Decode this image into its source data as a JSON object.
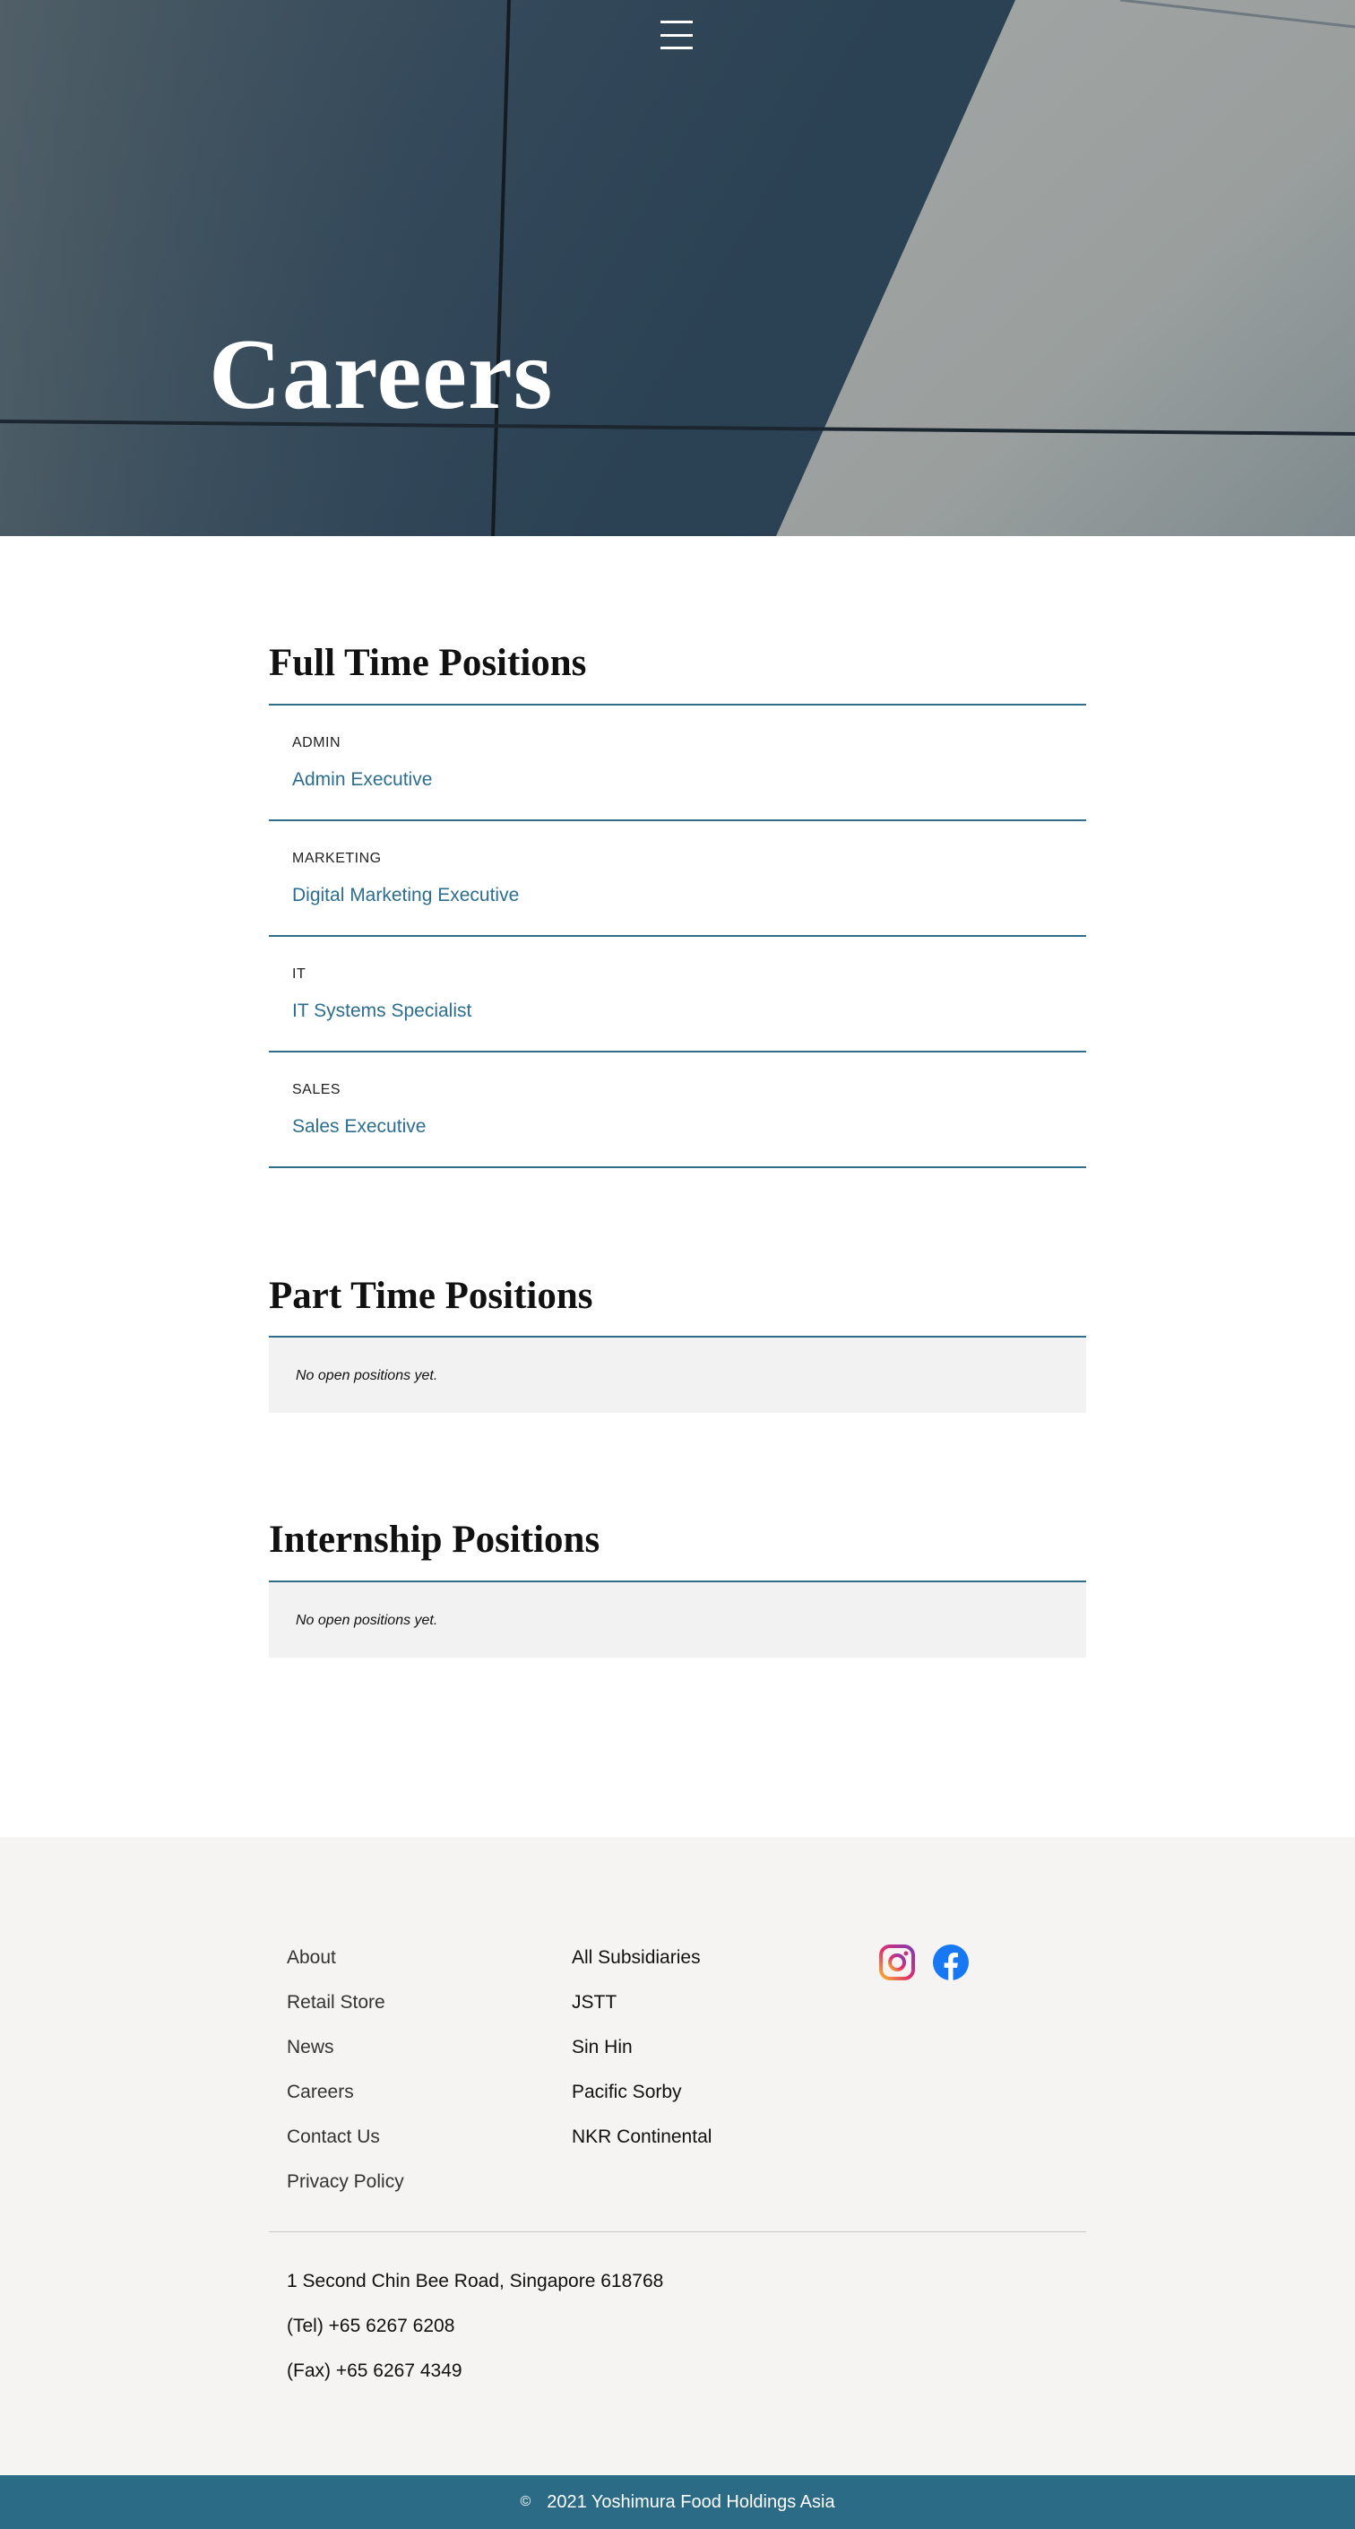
{
  "hero": {
    "title": "Careers",
    "menu_icon": "hamburger-menu-icon"
  },
  "full_time": {
    "title": "Full Time Positions",
    "jobs": [
      {
        "department": "ADMIN",
        "title": "Admin Executive"
      },
      {
        "department": "MARKETING",
        "title": "Digital Marketing Executive"
      },
      {
        "department": "IT",
        "title": "IT Systems Specialist"
      },
      {
        "department": "SALES",
        "title": "Sales Executive"
      }
    ]
  },
  "part_time": {
    "title": "Part Time Positions",
    "empty_text": "No open positions yet."
  },
  "internship": {
    "title": "Internship Positions",
    "empty_text": "No open positions yet."
  },
  "footer": {
    "links_col1": [
      "About",
      "Retail Store",
      "News",
      "Careers",
      "Contact Us",
      "Privacy Policy"
    ],
    "links_col2": [
      "All Subsidiaries",
      "JSTT",
      "Sin Hin",
      "Pacific Sorby",
      "NKR Continental"
    ],
    "social": [
      "instagram-icon",
      "facebook-icon"
    ],
    "address": "1 Second Chin Bee Road, Singapore 618768",
    "tel": "(Tel) +65 6267 6208",
    "fax": "(Fax) +65 6267 4349"
  },
  "copyright": {
    "symbol": "©",
    "text": "2021 Yoshimura Food Holdings Asia"
  },
  "colors": {
    "accent": "#2f6e8a",
    "link": "#2c6e8f",
    "footer_bg": "#f5f4f2",
    "bottom_bar": "#2b6b86"
  }
}
